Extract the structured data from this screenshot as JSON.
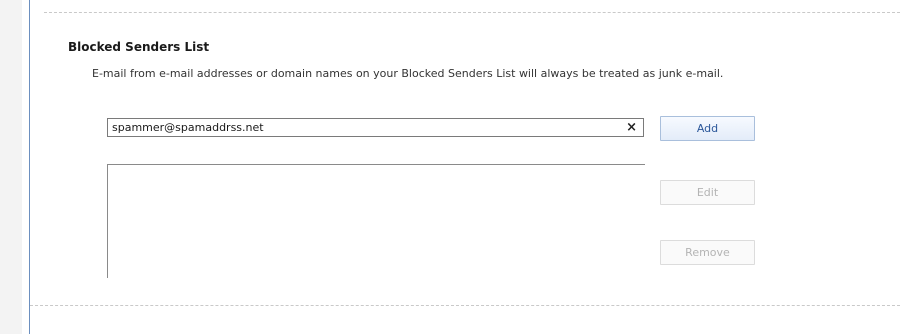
{
  "blocked_senders": {
    "title": "Blocked Senders List",
    "description": "E-mail from e-mail addresses or domain names on your Blocked Senders List will always be treated as junk e-mail.",
    "sender_input": {
      "value": "spammer@spamaddrss.net",
      "clear_glyph": "×"
    },
    "buttons": {
      "add_label": "Add",
      "edit_label": "Edit",
      "remove_label": "Remove"
    },
    "list_items": []
  },
  "icons": {
    "clear": "close-icon"
  },
  "colors": {
    "accent_border": "#6c8fbf",
    "add_button_text": "#2b579a",
    "disabled_text": "#b4b4b4"
  }
}
